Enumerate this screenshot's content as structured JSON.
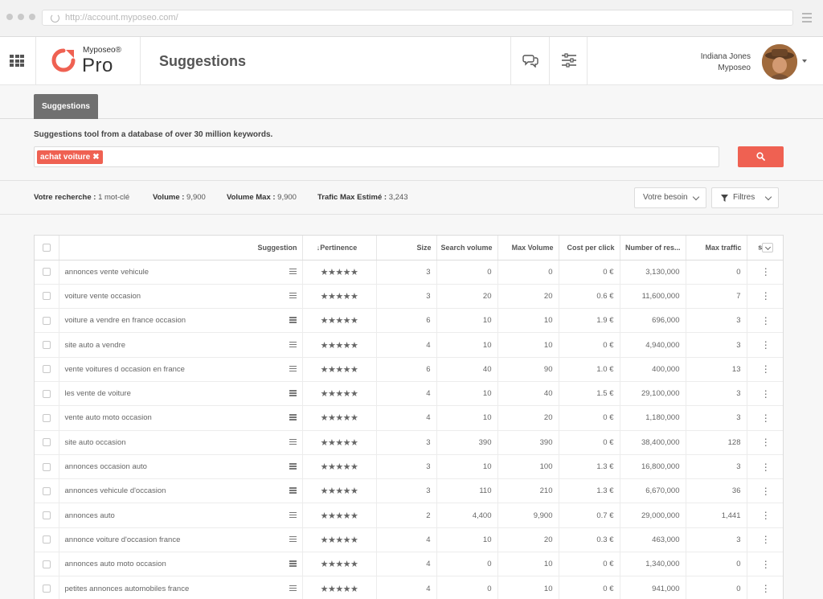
{
  "browser": {
    "url": "http://account.myposeo.com/"
  },
  "header": {
    "brand": "Myposeo®",
    "product": "Pro",
    "title": "Suggestions",
    "user_name": "Indiana Jones",
    "user_company": "Myposeo"
  },
  "tabs": [
    {
      "label": "Suggestions"
    }
  ],
  "description": "Suggestions tool from a database of over 30 million keywords.",
  "search": {
    "chip": "achat voiture",
    "chip_remove": "✖"
  },
  "stats": {
    "recherche_label": "Votre recherche :",
    "recherche_value": " 1 mot-clé",
    "volume_label": "Volume :",
    "volume_value": " 9,900",
    "volume_max_label": "Volume Max :",
    "volume_max_value": " 9,900",
    "trafic_label": "Trafic Max Estimé :",
    "trafic_value": " 3,243"
  },
  "toolbar": {
    "besoin_label": "Votre besoin",
    "filtres_label": "Filtres"
  },
  "table": {
    "columns": {
      "suggestion": "Suggestion",
      "pertinence": "↓Pertinence",
      "size": "Size",
      "search_volume": "Search volume",
      "max_volume": "Max Volume",
      "cpc": "Cost per click",
      "results": "Number of res...",
      "max_traffic": "Max traffic",
      "more": "s"
    },
    "stars": "★★★★★",
    "menu_glyph": "⋮",
    "rows": [
      {
        "keyword": "annonces vente vehicule",
        "size": "3",
        "search_volume": "0",
        "max_volume": "0",
        "cpc": "0 €",
        "results": "3,130,000",
        "max_traffic": "0"
      },
      {
        "keyword": "voiture vente occasion",
        "size": "3",
        "search_volume": "20",
        "max_volume": "20",
        "cpc": "0.6 €",
        "results": "11,600,000",
        "max_traffic": "7"
      },
      {
        "keyword": "voiture a vendre en france occasion",
        "size": "6",
        "search_volume": "10",
        "max_volume": "10",
        "cpc": "1.9 €",
        "results": "696,000",
        "max_traffic": "3"
      },
      {
        "keyword": "site auto a vendre",
        "size": "4",
        "search_volume": "10",
        "max_volume": "10",
        "cpc": "0 €",
        "results": "4,940,000",
        "max_traffic": "3"
      },
      {
        "keyword": "vente voitures d occasion en france",
        "size": "6",
        "search_volume": "40",
        "max_volume": "90",
        "cpc": "1.0 €",
        "results": "400,000",
        "max_traffic": "13"
      },
      {
        "keyword": "les vente de voiture",
        "size": "4",
        "search_volume": "10",
        "max_volume": "40",
        "cpc": "1.5 €",
        "results": "29,100,000",
        "max_traffic": "3"
      },
      {
        "keyword": "vente auto moto occasion",
        "size": "4",
        "search_volume": "10",
        "max_volume": "20",
        "cpc": "0 €",
        "results": "1,180,000",
        "max_traffic": "3"
      },
      {
        "keyword": "site auto occasion",
        "size": "3",
        "search_volume": "390",
        "max_volume": "390",
        "cpc": "0 €",
        "results": "38,400,000",
        "max_traffic": "128"
      },
      {
        "keyword": "annonces occasion auto",
        "size": "3",
        "search_volume": "10",
        "max_volume": "100",
        "cpc": "1.3 €",
        "results": "16,800,000",
        "max_traffic": "3"
      },
      {
        "keyword": "annonces vehicule d'occasion",
        "size": "3",
        "search_volume": "110",
        "max_volume": "210",
        "cpc": "1.3 €",
        "results": "6,670,000",
        "max_traffic": "36"
      },
      {
        "keyword": "annonces auto",
        "size": "2",
        "search_volume": "4,400",
        "max_volume": "9,900",
        "cpc": "0.7 €",
        "results": "29,000,000",
        "max_traffic": "1,441"
      },
      {
        "keyword": "annonce voiture d'occasion france",
        "size": "4",
        "search_volume": "10",
        "max_volume": "20",
        "cpc": "0.3 €",
        "results": "463,000",
        "max_traffic": "3"
      },
      {
        "keyword": "annonces auto moto occasion",
        "size": "4",
        "search_volume": "0",
        "max_volume": "10",
        "cpc": "0 €",
        "results": "1,340,000",
        "max_traffic": "0"
      },
      {
        "keyword": "petites annonces automobiles france",
        "size": "4",
        "search_volume": "0",
        "max_volume": "10",
        "cpc": "0 €",
        "results": "941,000",
        "max_traffic": "0"
      }
    ]
  },
  "colors": {
    "accent": "#ef6152",
    "tab": "#707070",
    "background": "#f7f7f7"
  }
}
